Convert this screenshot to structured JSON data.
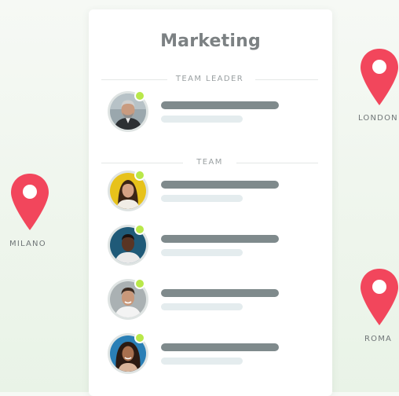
{
  "card": {
    "title": "Marketing",
    "sections": {
      "leader_label": "TEAM LEADER",
      "team_label": "TEAM"
    }
  },
  "members": {
    "leader": {
      "status": "online",
      "avatar": "man-gray-hair-avatar"
    },
    "team": [
      {
        "status": "online",
        "avatar": "woman-yellow-background-avatar"
      },
      {
        "status": "online",
        "avatar": "man-dark-skin-avatar"
      },
      {
        "status": "online",
        "avatar": "man-smiling-avatar"
      },
      {
        "status": "online",
        "avatar": "woman-curly-hair-avatar"
      }
    ]
  },
  "locations": {
    "london": "LONDON",
    "milano": "MILANO",
    "roma": "ROMA"
  },
  "colors": {
    "pin": "#f2465c",
    "status_online": "#b9e84a",
    "name_bar": "#7f8a8c",
    "role_bar": "#e4ecee",
    "title": "#7c8183"
  }
}
